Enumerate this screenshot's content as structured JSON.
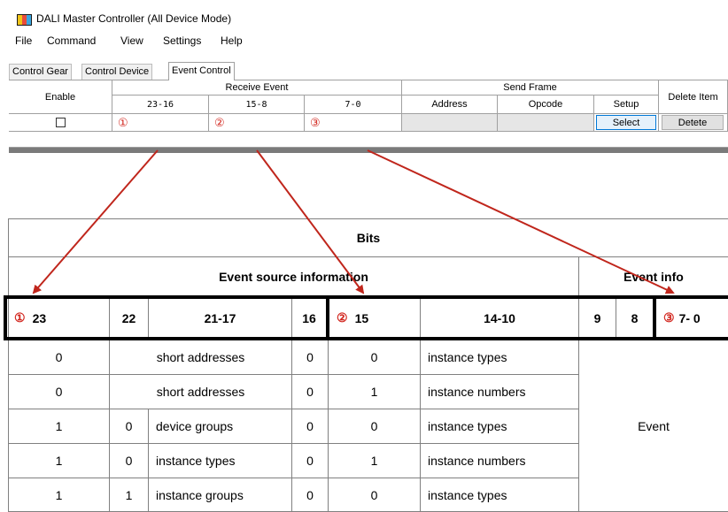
{
  "window": {
    "title": "DALI Master Controller (All Device Mode)"
  },
  "menu": [
    "File",
    "Command",
    "View",
    "Settings",
    "Help"
  ],
  "tabs": [
    "Control Gear",
    "Control Device",
    "Event Control"
  ],
  "active_tab": "Event Control",
  "event_grid": {
    "headers": {
      "enable": "Enable",
      "receive_event": "Receive Event",
      "send_frame": "Send Frame",
      "delete_item": "Delete Item",
      "bits_23_16": "23-16",
      "bits_15_8": "15-8",
      "bits_7_0": "7-0",
      "address": "Address",
      "opcode": "Opcode",
      "setup": "Setup"
    },
    "row": {
      "enabled": false,
      "marker_1": "①",
      "marker_2": "②",
      "marker_3": "③",
      "select_button": "Select",
      "delete_button": "Detete"
    }
  },
  "bits_table": {
    "title": "Bits",
    "event_source_label": "Event source information",
    "event_info_label": "Event info",
    "bit_headers": {
      "b23": "23",
      "b22": "22",
      "b21_17": "21-17",
      "b16": "16",
      "b15": "15",
      "b14_10": "14-10",
      "b9": "9",
      "b8": "8",
      "b7_0": "7- 0"
    },
    "markers": {
      "m1": "①",
      "m2": "②",
      "m3": "③"
    },
    "rows": [
      {
        "b23": "0",
        "b22": "",
        "b21_17": "short addresses",
        "b16": "0",
        "b15": "0",
        "b14_10": "instance types"
      },
      {
        "b23": "0",
        "b22": "",
        "b21_17": "short addresses",
        "b16": "0",
        "b15": "1",
        "b14_10": "instance numbers"
      },
      {
        "b23": "1",
        "b22": "0",
        "b21_17": "device groups",
        "b16": "0",
        "b15": "0",
        "b14_10": "instance types"
      },
      {
        "b23": "1",
        "b22": "0",
        "b21_17": "instance types",
        "b16": "0",
        "b15": "1",
        "b14_10": "instance numbers"
      },
      {
        "b23": "1",
        "b22": "1",
        "b21_17": "instance groups",
        "b16": "0",
        "b15": "0",
        "b14_10": "instance types"
      }
    ],
    "event_cell": "Event"
  },
  "colors": {
    "arrow": "#c0261c",
    "marker": "#d2261e",
    "border": "#808080"
  }
}
